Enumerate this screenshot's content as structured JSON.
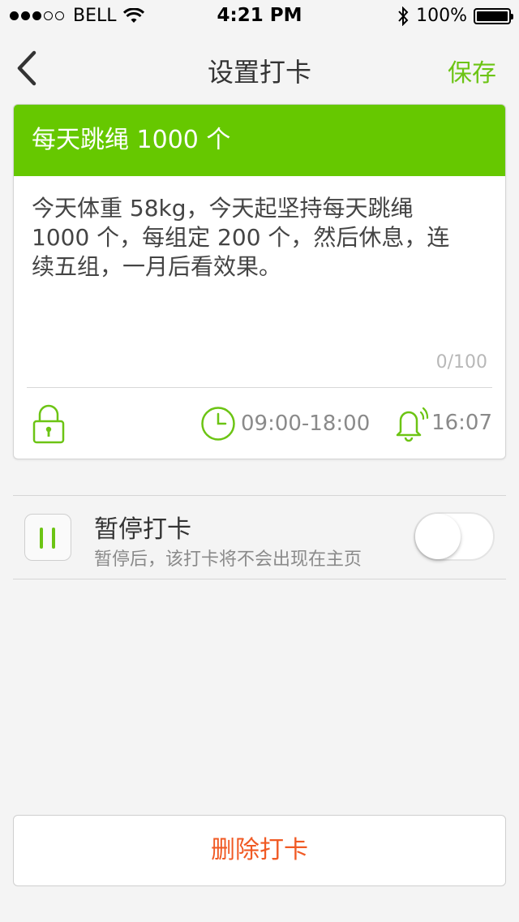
{
  "status_bar": {
    "carrier": "BELL",
    "signal_bars_filled": 3,
    "signal_bars_total": 5,
    "time": "4:21 PM",
    "battery_percent": "100%"
  },
  "nav": {
    "title": "设置打卡",
    "save_label": "保存"
  },
  "card": {
    "header_title": "每天跳绳 1000 个",
    "note_text": "今天体重 58kg，今天起坚持每天跳绳 1000 个，每组定 200 个，然后休息，连续五组，一月后看效果。",
    "char_count": "0/100",
    "time_range": "09:00-18:00",
    "reminder_time": "16:07"
  },
  "pause": {
    "title": "暂停打卡",
    "subtitle": "暂停后，该打卡将不会出现在主页",
    "enabled": false
  },
  "delete_label": "删除打卡",
  "colors": {
    "accent_green": "#66c800",
    "delete_red": "#f05a24",
    "background": "#f4f4f4"
  }
}
